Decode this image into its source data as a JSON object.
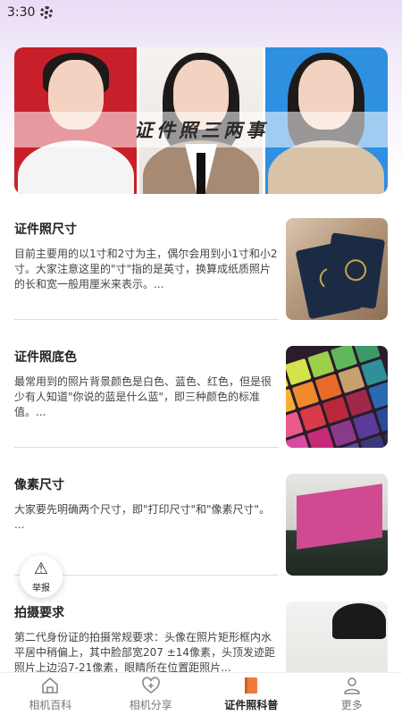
{
  "status_bar": {
    "time": "3:30",
    "icon": "settings-gear-icon"
  },
  "banner": {
    "title": "证件照三两事",
    "portrait_backgrounds": [
      "#c8202a",
      "#f3eee9",
      "#2f8fe0"
    ]
  },
  "articles": [
    {
      "title": "证件照尺寸",
      "summary": "目前主要用的以1寸和2寸为主，偶尔会用到小1寸和小2寸。大家注意这里的\"寸\"指的是英寸，换算成纸质照片的长和宽一般用厘米来表示。...",
      "image": "passport-photo"
    },
    {
      "title": "证件照底色",
      "summary": "最常用到的照片背景颜色是白色、蓝色、红色，但是很少有人知道\"你说的蓝是什么蓝\"，即三种颜色的标准值。...",
      "image": "color-swatches-photo"
    },
    {
      "title": "像素尺寸",
      "summary": "大家要先明确两个尺寸，即\"打印尺寸\"和\"像素尺寸\"。\n...",
      "image": "printing-press-photo"
    },
    {
      "title": "拍摄要求",
      "summary": "第二代身份证的拍摄常规要求：头像在照片矩形框内水平居中稍偏上，其中脸部宽207 ±14像素，头顶发迹距照片上边沿7-21像素，眼睛所在位置距照片...",
      "image": "photo-studio-photo"
    }
  ],
  "report_button": {
    "label": "举报",
    "icon": "warning-triangle-icon"
  },
  "bottom_nav": {
    "active_index": 2,
    "items": [
      {
        "label": "相机百科",
        "icon": "home-icon"
      },
      {
        "label": "相机分享",
        "icon": "heart-plus-icon"
      },
      {
        "label": "证件照科普",
        "icon": "book-icon"
      },
      {
        "label": "更多",
        "icon": "person-icon"
      }
    ],
    "active_color": "#f07a3a"
  }
}
